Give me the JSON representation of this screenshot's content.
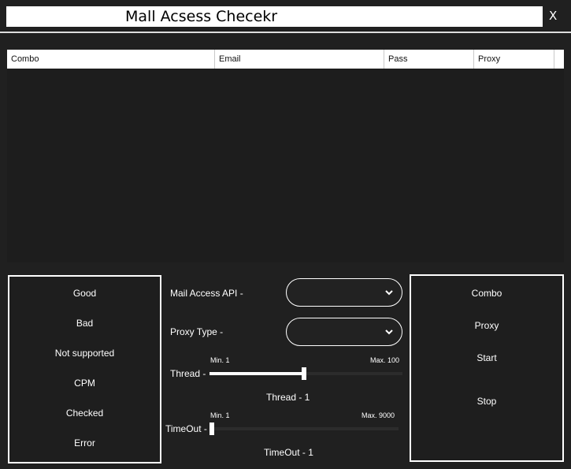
{
  "app": {
    "title": "Mall Acsess Checekr",
    "close_label": "X"
  },
  "table": {
    "columns": [
      "Combo",
      "Email",
      "Pass",
      "Proxy"
    ],
    "rows": []
  },
  "stats": [
    "Good",
    "Bad",
    "Not supported",
    "CPM",
    "Checked",
    "Error"
  ],
  "settings": {
    "api_label": "Mail Access API -",
    "api_value": "",
    "proxy_type_label": "Proxy Type -",
    "proxy_type_value": "",
    "thread": {
      "label": "Thread -",
      "min_label": "Min. 1",
      "max_label": "Max. 100",
      "min": 1,
      "max": 100,
      "value": 1,
      "value_label": "Thread - 1"
    },
    "timeout": {
      "label": "TimeOut -",
      "min_label": "Min. 1",
      "max_label": "Max. 9000",
      "min": 1,
      "max": 9000,
      "value": 1,
      "value_label": "TimeOut - 1"
    }
  },
  "actions": [
    "Combo",
    "Proxy",
    "Start",
    "Stop"
  ],
  "icons": {
    "dropdown": "chevron-down-icon"
  }
}
